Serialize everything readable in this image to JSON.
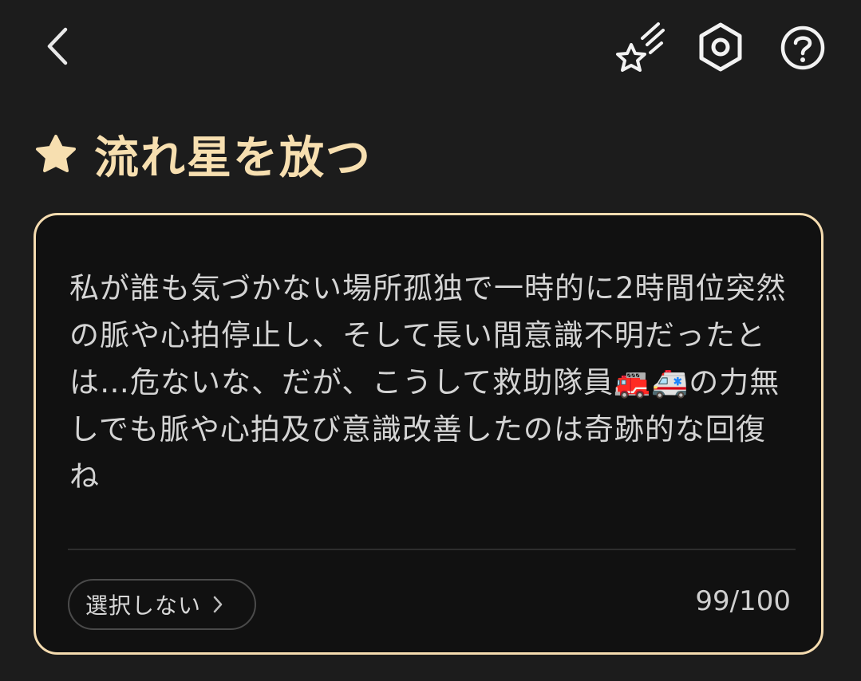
{
  "header": {
    "back_icon": "chevron-left-icon",
    "actions": [
      {
        "icon": "shooting-star-icon"
      },
      {
        "icon": "hexagon-settings-icon"
      },
      {
        "icon": "help-circle-icon"
      }
    ]
  },
  "title": {
    "icon": "star-icon",
    "text": "流れ星を放つ"
  },
  "card": {
    "message": "私が誰も気づかない場所孤独で一時的に2時間位突然の脈や心拍停止し、そして長い間意識不明だったとは…危ないな、だが、こうして救助隊員🚒🚑の力無しでも脈や心拍及び意識改善したのは奇跡的な回復ね",
    "select_label": "選択しない",
    "counter": "99/100"
  },
  "colors": {
    "background": "#1c1c1c",
    "card_background": "#111111",
    "accent": "#f5dcb0",
    "text": "#d4d4d4"
  }
}
